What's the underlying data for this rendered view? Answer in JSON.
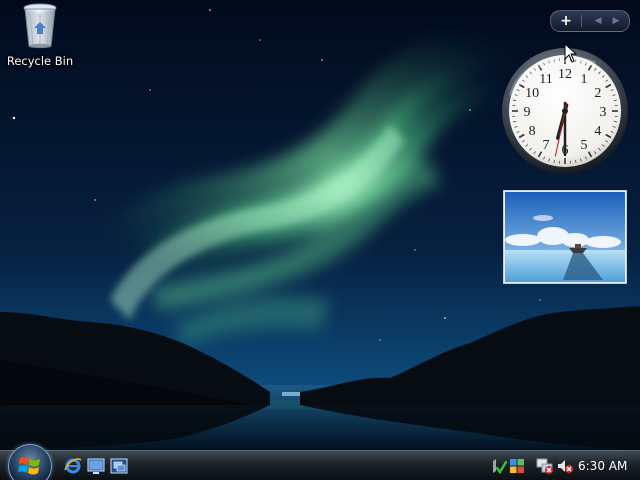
{
  "desktop": {
    "icons": [
      {
        "label": "Recycle Bin",
        "icon": "recycle-bin-icon"
      }
    ]
  },
  "sidebar": {
    "controls": {
      "add_glyph": "+",
      "prev_glyph": "◀",
      "next_glyph": "▶"
    },
    "clock": {
      "hour": 6,
      "minute": 30,
      "numerals": [
        "12",
        "1",
        "2",
        "3",
        "4",
        "5",
        "6",
        "7",
        "8",
        "9",
        "10",
        "11"
      ]
    },
    "slideshow": {
      "icon": "landscape-photo"
    }
  },
  "taskbar": {
    "start_icon": "windows-logo-icon",
    "quick_launch": [
      "internet-explorer-icon",
      "show-desktop-icon",
      "switch-windows-icon"
    ],
    "tray": {
      "icons": [
        "windows-defender-icon",
        "security-center-icon",
        "network-disconnected-icon",
        "volume-muted-icon"
      ],
      "time": "6:30 AM"
    }
  },
  "colors": {
    "aurora": "#7fe6a8",
    "night_sky": "#04162e",
    "taskbar": "#1c2329",
    "text": "#ffffff"
  }
}
